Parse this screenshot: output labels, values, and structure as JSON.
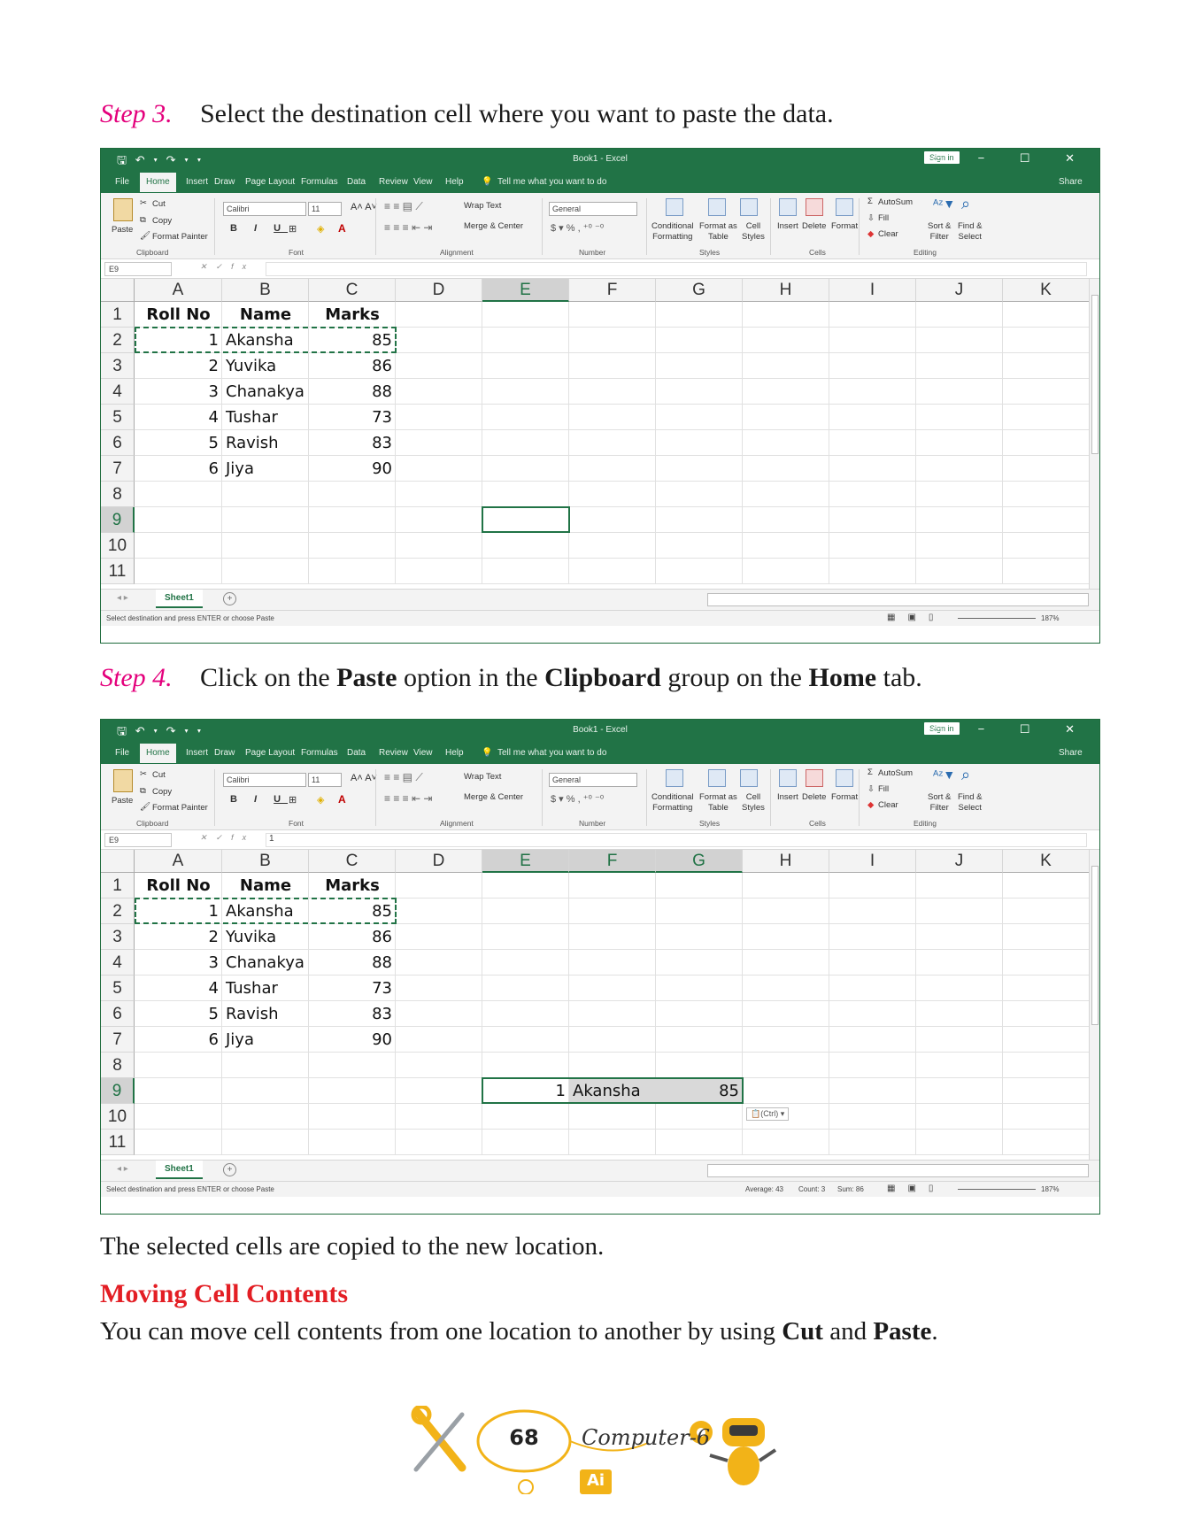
{
  "step3": {
    "label": "Step 3.",
    "text": "Select the destination cell where you want to paste the data."
  },
  "step4": {
    "label": "Step 4.",
    "t1": "Click on the ",
    "b1": "Paste",
    "t2": " option in the ",
    "b2": "Clipboard",
    "t3": " group on the ",
    "b3": "Home",
    "t4": " tab."
  },
  "excel": {
    "quick_access": "🖫 ↶ ▾ ↷ ▾ ▾",
    "title": "Book1  -  Excel",
    "sign_in": "Sign in",
    "window_controls": "▭ − ☐ ✕",
    "tabs": [
      "File",
      "Home",
      "Insert",
      "Draw",
      "Page Layout",
      "Formulas",
      "Data",
      "Review",
      "View",
      "Help"
    ],
    "tell_me": "Tell me what you want to do",
    "share": "Share",
    "ribbon": {
      "paste": "Paste",
      "cut": "Cut",
      "copy": "Copy",
      "format_painter": "Format Painter",
      "clipboard": "Clipboard",
      "font_name": "Calibri",
      "font_size": "11",
      "font": "Font",
      "wrap_text": "Wrap Text",
      "merge_center": "Merge & Center",
      "alignment": "Alignment",
      "number_format": "General",
      "number": "Number",
      "cond_fmt": "Conditional",
      "cond_fmt2": "Formatting",
      "fmt_table": "Format as",
      "fmt_table2": "Table",
      "cell_styles": "Cell",
      "cell_styles2": "Styles",
      "styles": "Styles",
      "insert": "Insert",
      "delete": "Delete",
      "format": "Format",
      "cells": "Cells",
      "autosum": "AutoSum",
      "fill": "Fill",
      "clear": "Clear",
      "sort": "Sort &",
      "sort2": "Filter",
      "find": "Find &",
      "find2": "Select",
      "editing": "Editing"
    },
    "name_box": "E9",
    "fx": "fx",
    "columns": [
      "A",
      "B",
      "C",
      "D",
      "E",
      "F",
      "G",
      "H",
      "I",
      "J",
      "K"
    ],
    "rows": [
      "1",
      "2",
      "3",
      "4",
      "5",
      "6",
      "7",
      "8",
      "9",
      "10",
      "11"
    ],
    "headers": [
      "Roll No",
      "Name",
      "Marks"
    ],
    "data": [
      [
        "1",
        "Akansha",
        "85"
      ],
      [
        "2",
        "Yuvika",
        "86"
      ],
      [
        "3",
        "Chanakya",
        "88"
      ],
      [
        "4",
        "Tushar",
        "73"
      ],
      [
        "5",
        "Ravish",
        "83"
      ],
      [
        "6",
        "Jiya",
        "90"
      ]
    ],
    "sheet_tab": "Sheet1",
    "status_text": "Select destination and press ENTER or choose Paste",
    "zoom": "187%"
  },
  "excel2": {
    "formula_value": "1",
    "pasted": [
      "1",
      "Akansha",
      "85"
    ],
    "paste_tag": "(Ctrl) ▾",
    "average": "Average: 43",
    "count": "Count: 3",
    "sum": "Sum: 86"
  },
  "result_text": "The selected cells are copied to the new location.",
  "heading": "Moving Cell Contents",
  "move": {
    "t1": "You can move cell contents from one location to another by using ",
    "b1": "Cut",
    "t2": " and ",
    "b2": "Paste",
    "t3": "."
  },
  "footer": {
    "page": "68",
    "book": "Computer-6",
    "badge": "Ai"
  },
  "colors": {
    "excel_green": "#217346",
    "step_label": "#e4007c",
    "heading": "#e31e24"
  }
}
